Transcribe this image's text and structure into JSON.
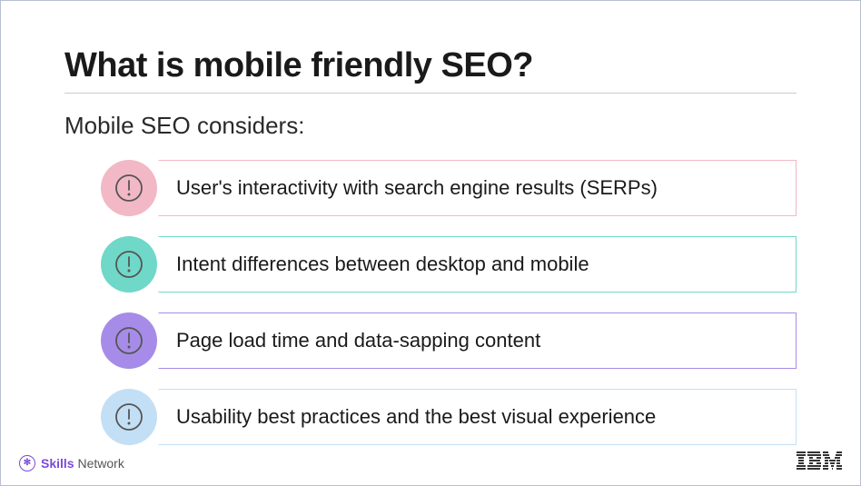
{
  "title": "What is mobile friendly SEO?",
  "subtitle": "Mobile SEO considers:",
  "items": [
    {
      "text": "User's interactivity with search engine results (SERPs)",
      "color": "#f2b8c6"
    },
    {
      "text": "Intent differences between desktop and mobile",
      "color": "#6fd8c8"
    },
    {
      "text": "Page load time and data-sapping content",
      "color": "#a68ce8"
    },
    {
      "text": "Usability best practices and the best visual experience",
      "color": "#c3dff5"
    }
  ],
  "footer": {
    "brand": "Skills",
    "network": "Network",
    "logo": "IBM"
  }
}
